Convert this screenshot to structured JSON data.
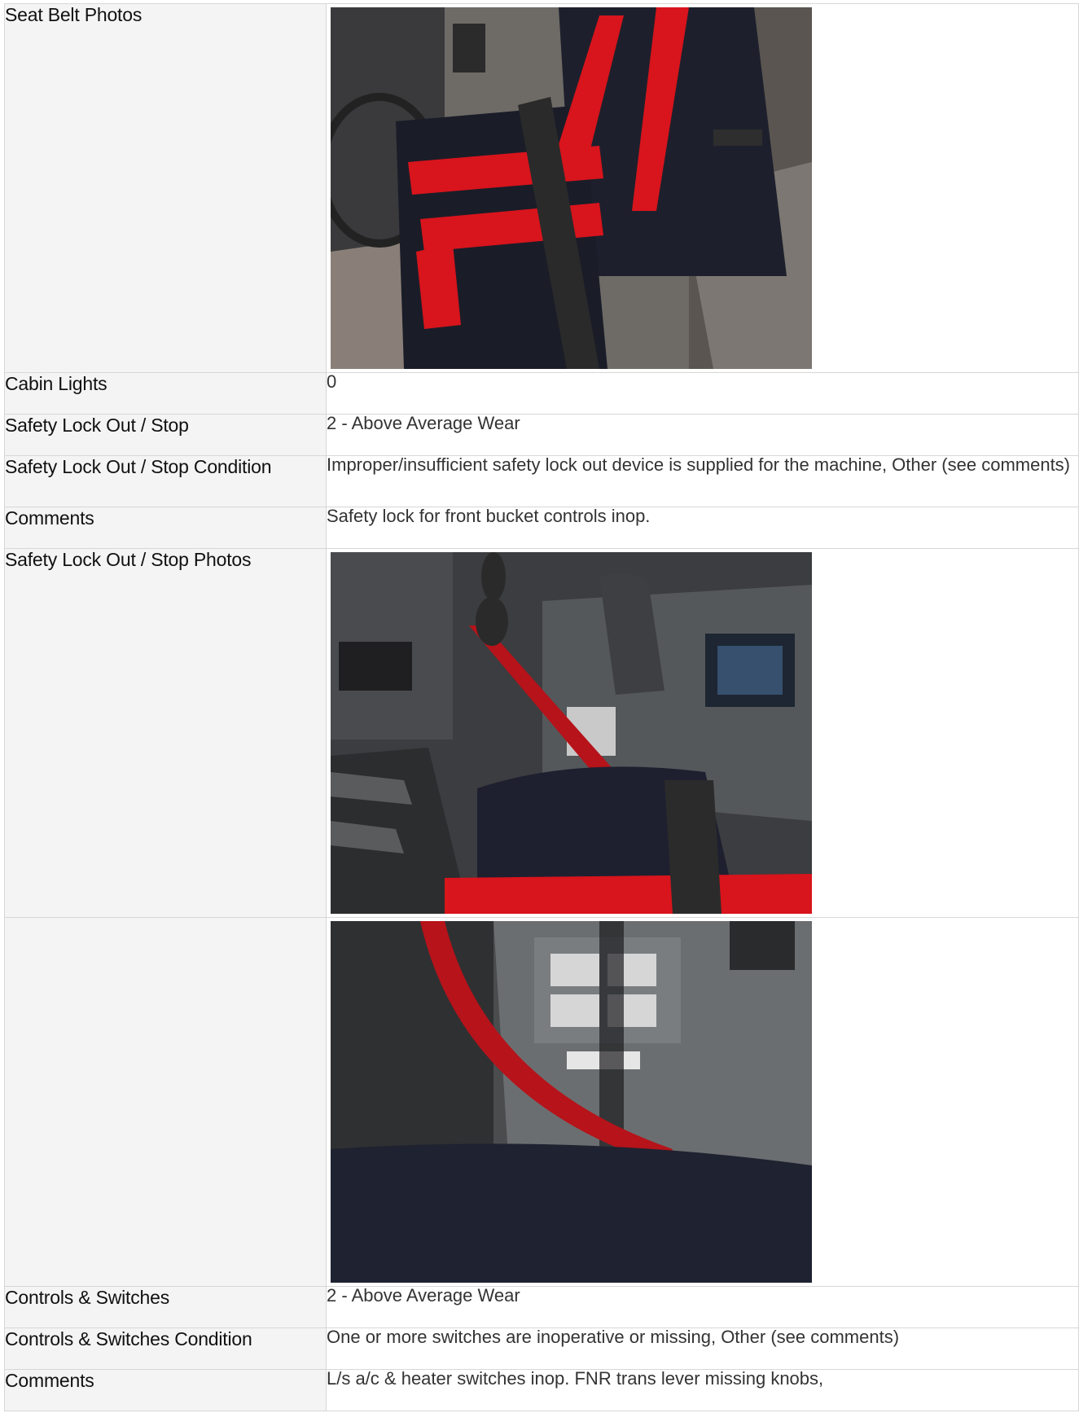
{
  "rows": {
    "seat_belt_photos": {
      "label": "Seat Belt Photos"
    },
    "cabin_lights": {
      "label": "Cabin Lights",
      "value": "0"
    },
    "safety_lock": {
      "label": "Safety Lock Out / Stop",
      "value": "2 - Above Average Wear"
    },
    "safety_lock_condition": {
      "label": "Safety Lock Out / Stop Condition",
      "value": "Improper/insufficient safety lock out device is supplied for the machine, Other (see comments)"
    },
    "comments_1": {
      "label": "Comments",
      "value": "Safety lock for front bucket controls inop."
    },
    "safety_lock_photos": {
      "label": "Safety Lock Out / Stop Photos"
    },
    "controls_switches": {
      "label": "Controls & Switches",
      "value": "2 - Above Average Wear"
    },
    "controls_switches_condition": {
      "label": "Controls & Switches Condition",
      "value": "One or more switches are inoperative or missing, Other (see comments)"
    },
    "comments_2": {
      "label": "Comments",
      "value": "L/s a/c & heater switches inop. FNR trans lever missing knobs,"
    }
  },
  "colors": {
    "label_bg": "#f4f4f4",
    "border": "#d7d7d7",
    "seat_red": "#d8141c",
    "seat_dark": "#1c1f2b"
  }
}
